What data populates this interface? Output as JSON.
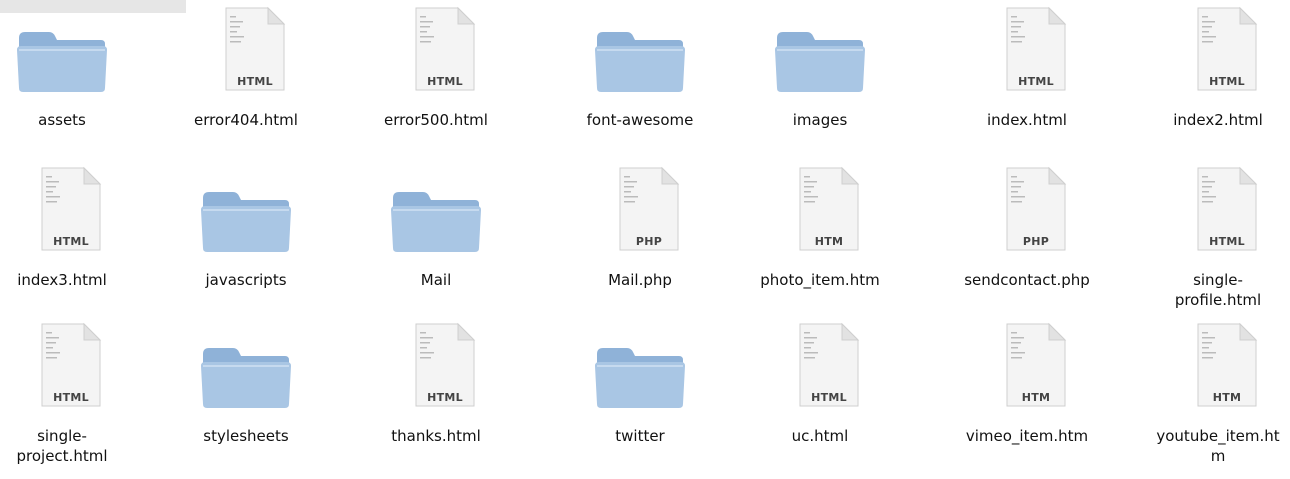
{
  "window": {
    "toolbar_color": "#e6e6e6"
  },
  "colors": {
    "folder_front": "#a9c6e4",
    "folder_back": "#8fb2d8",
    "doc_page": "#f4f4f4",
    "label_text": "#111111"
  },
  "files": [
    {
      "name": "assets",
      "kind": "folder",
      "icon": "folder-icon"
    },
    {
      "name": "error404.html",
      "kind": "doc",
      "badge": "HTML",
      "icon": "html-file-icon"
    },
    {
      "name": "error500.html",
      "kind": "doc",
      "badge": "HTML",
      "icon": "html-file-icon"
    },
    {
      "name": "font-awesome",
      "kind": "folder",
      "icon": "folder-icon"
    },
    {
      "name": "images",
      "kind": "folder",
      "icon": "folder-icon"
    },
    {
      "name": "index.html",
      "kind": "doc",
      "badge": "HTML",
      "icon": "html-file-icon"
    },
    {
      "name": "index2.html",
      "kind": "doc",
      "badge": "HTML",
      "icon": "html-file-icon"
    },
    {
      "name": "index3.html",
      "kind": "doc",
      "badge": "HTML",
      "icon": "html-file-icon"
    },
    {
      "name": "javascripts",
      "kind": "folder",
      "icon": "folder-icon"
    },
    {
      "name": "Mail",
      "kind": "folder",
      "icon": "folder-icon"
    },
    {
      "name": "Mail.php",
      "kind": "doc",
      "badge": "PHP",
      "icon": "php-file-icon"
    },
    {
      "name": "photo_item.htm",
      "kind": "doc",
      "badge": "HTM",
      "icon": "htm-file-icon"
    },
    {
      "name": "sendcontact.php",
      "kind": "doc",
      "badge": "PHP",
      "icon": "php-file-icon"
    },
    {
      "name": "single-\nprofile.html",
      "kind": "doc",
      "badge": "HTML",
      "icon": "html-file-icon"
    },
    {
      "name": "single-\nproject.html",
      "kind": "doc",
      "badge": "HTML",
      "icon": "html-file-icon"
    },
    {
      "name": "stylesheets",
      "kind": "folder",
      "icon": "folder-icon"
    },
    {
      "name": "thanks.html",
      "kind": "doc",
      "badge": "HTML",
      "icon": "html-file-icon"
    },
    {
      "name": "twitter",
      "kind": "folder",
      "icon": "folder-icon"
    },
    {
      "name": "uc.html",
      "kind": "doc",
      "badge": "HTML",
      "icon": "html-file-icon"
    },
    {
      "name": "vimeo_item.htm",
      "kind": "doc",
      "badge": "HTM",
      "icon": "htm-file-icon"
    },
    {
      "name": "youtube_item.ht\nm",
      "kind": "doc",
      "badge": "HTM",
      "icon": "htm-file-icon"
    }
  ]
}
